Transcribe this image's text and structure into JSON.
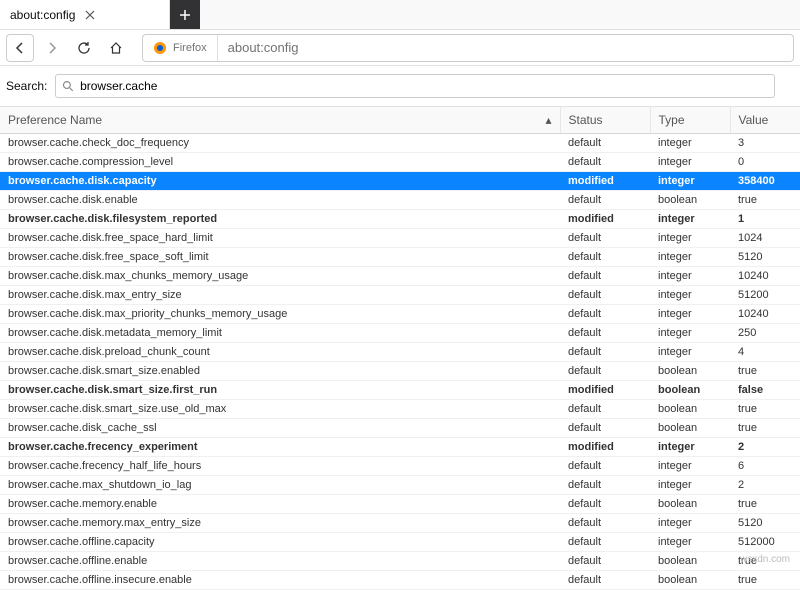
{
  "tab": {
    "title": "about:config"
  },
  "url": {
    "identity": "Firefox",
    "value": "about:config"
  },
  "search": {
    "label": "Search:",
    "value": "browser.cache"
  },
  "columns": {
    "name": "Preference Name",
    "status": "Status",
    "type": "Type",
    "value": "Value"
  },
  "selectedIndex": 2,
  "prefs": [
    {
      "name": "browser.cache.check_doc_frequency",
      "status": "default",
      "type": "integer",
      "value": "3",
      "modified": false
    },
    {
      "name": "browser.cache.compression_level",
      "status": "default",
      "type": "integer",
      "value": "0",
      "modified": false
    },
    {
      "name": "browser.cache.disk.capacity",
      "status": "modified",
      "type": "integer",
      "value": "358400",
      "modified": true
    },
    {
      "name": "browser.cache.disk.enable",
      "status": "default",
      "type": "boolean",
      "value": "true",
      "modified": false
    },
    {
      "name": "browser.cache.disk.filesystem_reported",
      "status": "modified",
      "type": "integer",
      "value": "1",
      "modified": true
    },
    {
      "name": "browser.cache.disk.free_space_hard_limit",
      "status": "default",
      "type": "integer",
      "value": "1024",
      "modified": false
    },
    {
      "name": "browser.cache.disk.free_space_soft_limit",
      "status": "default",
      "type": "integer",
      "value": "5120",
      "modified": false
    },
    {
      "name": "browser.cache.disk.max_chunks_memory_usage",
      "status": "default",
      "type": "integer",
      "value": "10240",
      "modified": false
    },
    {
      "name": "browser.cache.disk.max_entry_size",
      "status": "default",
      "type": "integer",
      "value": "51200",
      "modified": false
    },
    {
      "name": "browser.cache.disk.max_priority_chunks_memory_usage",
      "status": "default",
      "type": "integer",
      "value": "10240",
      "modified": false
    },
    {
      "name": "browser.cache.disk.metadata_memory_limit",
      "status": "default",
      "type": "integer",
      "value": "250",
      "modified": false
    },
    {
      "name": "browser.cache.disk.preload_chunk_count",
      "status": "default",
      "type": "integer",
      "value": "4",
      "modified": false
    },
    {
      "name": "browser.cache.disk.smart_size.enabled",
      "status": "default",
      "type": "boolean",
      "value": "true",
      "modified": false
    },
    {
      "name": "browser.cache.disk.smart_size.first_run",
      "status": "modified",
      "type": "boolean",
      "value": "false",
      "modified": true
    },
    {
      "name": "browser.cache.disk.smart_size.use_old_max",
      "status": "default",
      "type": "boolean",
      "value": "true",
      "modified": false
    },
    {
      "name": "browser.cache.disk_cache_ssl",
      "status": "default",
      "type": "boolean",
      "value": "true",
      "modified": false
    },
    {
      "name": "browser.cache.frecency_experiment",
      "status": "modified",
      "type": "integer",
      "value": "2",
      "modified": true
    },
    {
      "name": "browser.cache.frecency_half_life_hours",
      "status": "default",
      "type": "integer",
      "value": "6",
      "modified": false
    },
    {
      "name": "browser.cache.max_shutdown_io_lag",
      "status": "default",
      "type": "integer",
      "value": "2",
      "modified": false
    },
    {
      "name": "browser.cache.memory.enable",
      "status": "default",
      "type": "boolean",
      "value": "true",
      "modified": false
    },
    {
      "name": "browser.cache.memory.max_entry_size",
      "status": "default",
      "type": "integer",
      "value": "5120",
      "modified": false
    },
    {
      "name": "browser.cache.offline.capacity",
      "status": "default",
      "type": "integer",
      "value": "512000",
      "modified": false
    },
    {
      "name": "browser.cache.offline.enable",
      "status": "default",
      "type": "boolean",
      "value": "true",
      "modified": false
    },
    {
      "name": "browser.cache.offline.insecure.enable",
      "status": "default",
      "type": "boolean",
      "value": "true",
      "modified": false
    }
  ],
  "watermark": "wsxdn.com"
}
